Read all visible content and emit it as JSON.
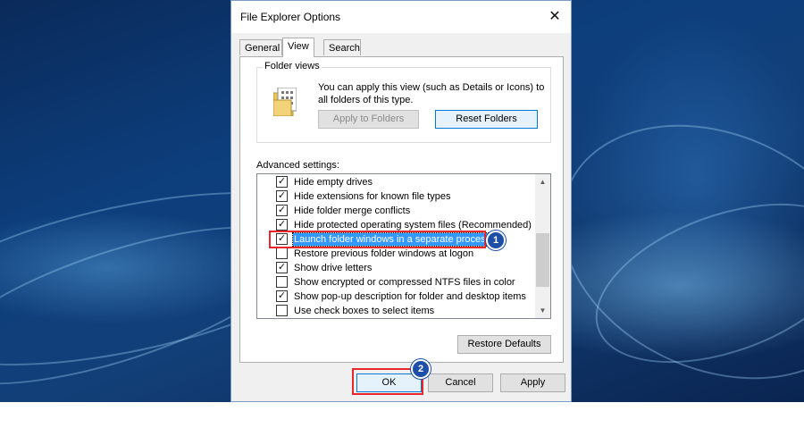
{
  "window": {
    "title": "File Explorer Options",
    "close_glyph": "✕"
  },
  "tabs": [
    {
      "label": "General",
      "active": false
    },
    {
      "label": "View",
      "active": true
    },
    {
      "label": "Search",
      "active": false
    }
  ],
  "folder_views": {
    "label": "Folder views",
    "description": "You can apply this view (such as Details or Icons) to all folders of this type.",
    "apply_button": "Apply to Folders",
    "reset_button": "Reset Folders"
  },
  "advanced": {
    "label": "Advanced settings:",
    "items": [
      {
        "label": "Hide empty drives",
        "checked": true,
        "selected": false
      },
      {
        "label": "Hide extensions for known file types",
        "checked": true,
        "selected": false
      },
      {
        "label": "Hide folder merge conflicts",
        "checked": true,
        "selected": false
      },
      {
        "label": "Hide protected operating system files (Recommended)",
        "checked": true,
        "selected": false
      },
      {
        "label": "Launch folder windows in a separate process",
        "checked": true,
        "selected": true
      },
      {
        "label": "Restore previous folder windows at logon",
        "checked": false,
        "selected": false
      },
      {
        "label": "Show drive letters",
        "checked": true,
        "selected": false
      },
      {
        "label": "Show encrypted or compressed NTFS files in color",
        "checked": false,
        "selected": false
      },
      {
        "label": "Show pop-up description for folder and desktop items",
        "checked": true,
        "selected": false
      },
      {
        "label": "Use check boxes to select items",
        "checked": false,
        "selected": false
      }
    ],
    "restore_defaults": "Restore Defaults"
  },
  "buttons": {
    "ok": "OK",
    "cancel": "Cancel",
    "apply": "Apply"
  },
  "annotations": {
    "badge1": "1",
    "badge2": "2"
  },
  "colors": {
    "highlight": "#e8262b",
    "badge": "#1e4fa8",
    "selection": "#3399ff"
  },
  "icons": {
    "check": "✓",
    "scroll_up": "▲",
    "scroll_down": "▼"
  }
}
